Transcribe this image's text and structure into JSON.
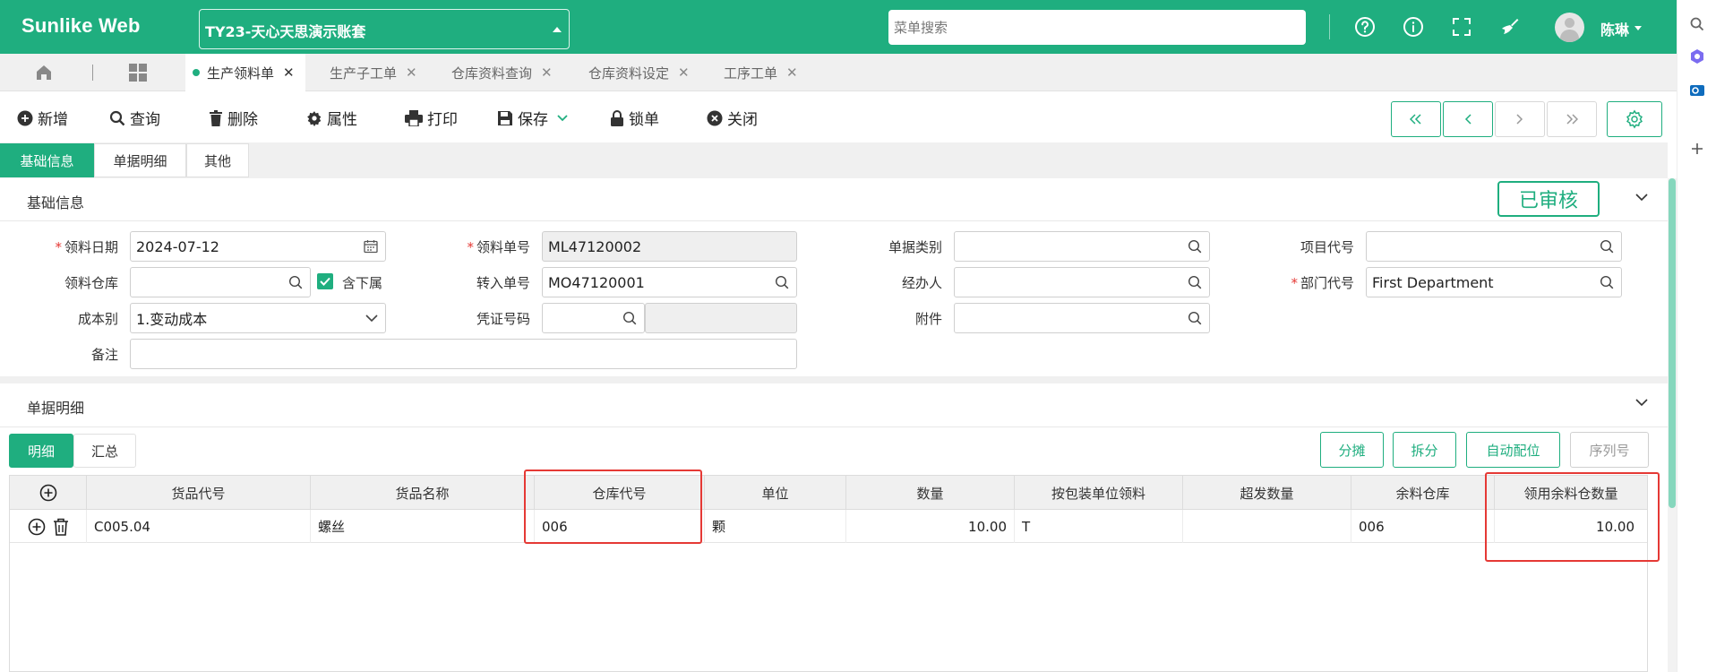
{
  "app": {
    "brand": "Sunlike Web",
    "account": "TY23-天心天思演示账套",
    "search_placeholder": "菜单搜索",
    "user": "陈琳"
  },
  "tabs": [
    {
      "label": "生产领料单",
      "active": true
    },
    {
      "label": "生产子工单"
    },
    {
      "label": "仓库资料查询"
    },
    {
      "label": "仓库资料设定"
    },
    {
      "label": "工序工单"
    }
  ],
  "toolbar": {
    "add": "新增",
    "query": "查询",
    "delete": "删除",
    "props": "属性",
    "print": "打印",
    "save": "保存",
    "lock": "锁单",
    "close": "关闭"
  },
  "section_tabs": [
    "基础信息",
    "单据明细",
    "其他"
  ],
  "basic": {
    "title": "基础信息",
    "status": "已审核",
    "labels": {
      "date": "领料日期",
      "doc_no": "领料单号",
      "doc_type": "单据类别",
      "project": "项目代号",
      "warehouse": "领料仓库",
      "include_sub": "含下属",
      "transfer_no": "转入单号",
      "handler": "经办人",
      "dept": "部门代号",
      "cost": "成本别",
      "voucher": "凭证号码",
      "attachment": "附件",
      "remark": "备注"
    },
    "values": {
      "date": "2024-07-12",
      "doc_no": "ML47120002",
      "transfer_no": "MO47120001",
      "dept": "First Department",
      "cost": "1.变动成本"
    }
  },
  "detail": {
    "title": "单据明细",
    "tabs": [
      "明细",
      "汇总"
    ],
    "buttons": [
      "分摊",
      "拆分",
      "自动配位",
      "序列号"
    ],
    "columns": [
      "货品代号",
      "货品名称",
      "仓库代号",
      "单位",
      "数量",
      "按包装单位领料",
      "超发数量",
      "余料仓库",
      "领用余料仓数量"
    ],
    "rows": [
      {
        "code": "C005.04",
        "name": "螺丝",
        "warehouse": "006",
        "unit": "颗",
        "qty": "10.00",
        "by_pack": "T",
        "over": "",
        "rem_wh": "006",
        "rem_qty": "10.00"
      }
    ]
  },
  "colors": {
    "accent": "#1fae7f",
    "highlight": "#e53935"
  }
}
